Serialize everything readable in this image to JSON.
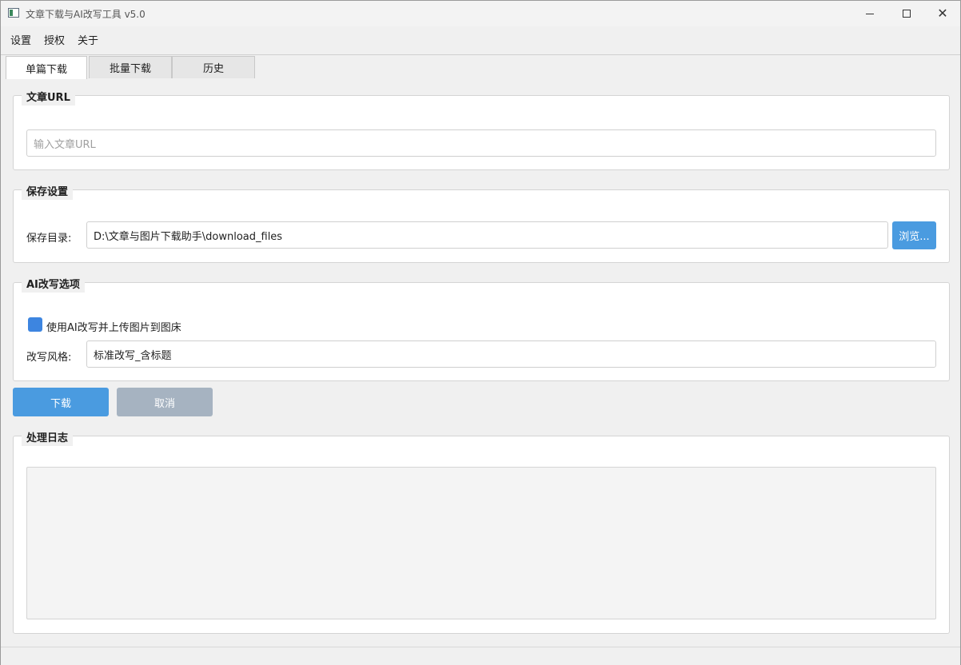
{
  "window": {
    "title": "文章下载与AI改写工具 v5.0"
  },
  "menu": {
    "items": [
      "设置",
      "授权",
      "关于"
    ]
  },
  "tabs": [
    {
      "label": "单篇下载",
      "active": true
    },
    {
      "label": "批量下载",
      "active": false
    },
    {
      "label": "历史",
      "active": false
    }
  ],
  "url_group": {
    "title": "文章URL",
    "input_placeholder": "输入文章URL",
    "input_value": ""
  },
  "save_group": {
    "title": "保存设置",
    "dir_label": "保存目录:",
    "dir_value": "D:\\文章与图片下载助手\\download_files",
    "browse_label": "浏览..."
  },
  "ai_group": {
    "title": "AI改写选项",
    "checkbox_label": "使用AI改写并上传图片到图床",
    "checkbox_checked": true,
    "style_label": "改写风格:",
    "style_value": "标准改写_含标题"
  },
  "actions": {
    "download_label": "下载",
    "cancel_label": "取消"
  },
  "log_group": {
    "title": "处理日志",
    "content": ""
  },
  "colors": {
    "accent": "#4a9be0",
    "checkbox": "#3d85e0",
    "disabled": "#a6b3c1"
  }
}
